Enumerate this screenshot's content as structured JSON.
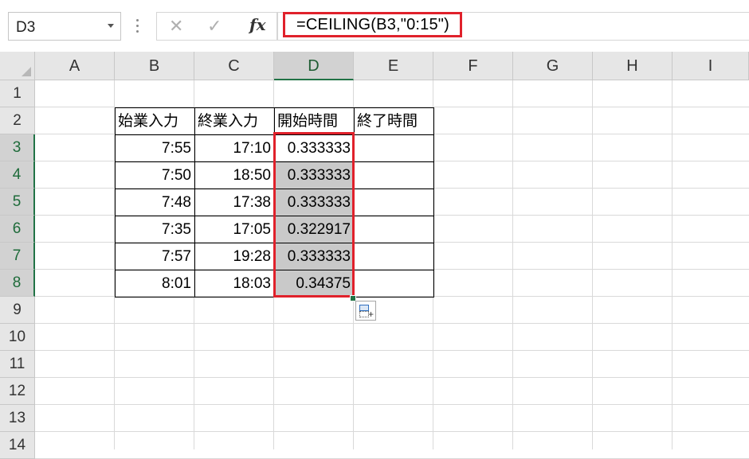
{
  "formula_bar": {
    "name_box": "D3",
    "cancel_icon": "✕",
    "enter_icon": "✓",
    "function_icon": "fx",
    "formula": "=CEILING(B3,\"0:15\")"
  },
  "columns": [
    "A",
    "B",
    "C",
    "D",
    "E",
    "F",
    "G",
    "H",
    "I"
  ],
  "selected_column": "D",
  "rows": [
    "1",
    "2",
    "3",
    "4",
    "5",
    "6",
    "7",
    "8",
    "9",
    "10",
    "11",
    "12",
    "13",
    "14"
  ],
  "selected_rows": [
    "3",
    "4",
    "5",
    "6",
    "7",
    "8"
  ],
  "table": {
    "headers": [
      "始業入力",
      "終業入力",
      "開始時間",
      "終了時間"
    ],
    "rows": [
      {
        "start_input": "7:55",
        "end_input": "17:10",
        "start_time": "0.333333",
        "end_time": ""
      },
      {
        "start_input": "7:50",
        "end_input": "18:50",
        "start_time": "0.333333",
        "end_time": ""
      },
      {
        "start_input": "7:48",
        "end_input": "17:38",
        "start_time": "0.333333",
        "end_time": ""
      },
      {
        "start_input": "7:35",
        "end_input": "17:05",
        "start_time": "0.322917",
        "end_time": ""
      },
      {
        "start_input": "7:57",
        "end_input": "19:28",
        "start_time": "0.333333",
        "end_time": ""
      },
      {
        "start_input": "8:01",
        "end_input": "18:03",
        "start_time": "0.34375",
        "end_time": ""
      }
    ]
  },
  "colors": {
    "highlight": "#e0212b",
    "excel_green": "#217346",
    "selection_fill": "#c9c9c9"
  }
}
